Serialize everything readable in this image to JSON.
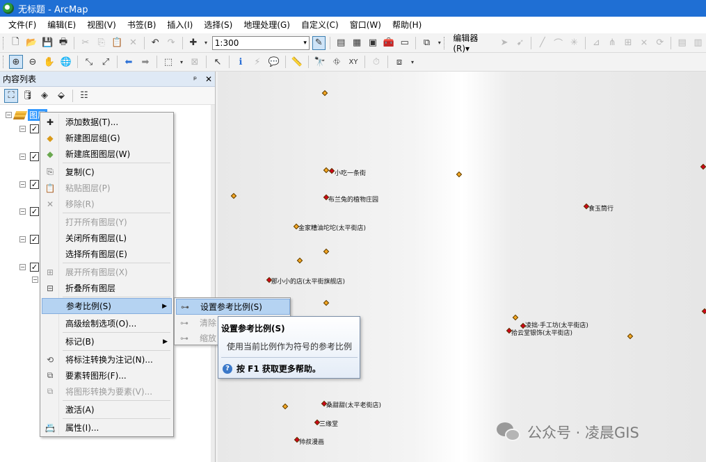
{
  "window": {
    "title": "无标题 - ArcMap"
  },
  "menubar": [
    "文件(F)",
    "编辑(E)",
    "视图(V)",
    "书签(B)",
    "插入(I)",
    "选择(S)",
    "地理处理(G)",
    "自定义(C)",
    "窗口(W)",
    "帮助(H)"
  ],
  "toolbar": {
    "scale": "1:300",
    "editor_label": "编辑器(R)▾"
  },
  "toc": {
    "title": "内容列表",
    "pin": "ᵖ",
    "close": "✕",
    "root_label": "图层"
  },
  "context_menu": [
    {
      "label": "添加数据(T)...",
      "icon": "add-data-icon",
      "enabled": true
    },
    {
      "label": "新建图层组(G)",
      "icon": "new-group-layer-icon",
      "enabled": true
    },
    {
      "label": "新建底图图层(W)",
      "icon": "new-basemap-layer-icon",
      "enabled": true
    },
    {
      "label": "复制(C)",
      "icon": "copy-icon",
      "enabled": true
    },
    {
      "label": "粘贴图层(P)",
      "icon": "paste-icon",
      "enabled": false
    },
    {
      "label": "移除(R)",
      "icon": "remove-icon",
      "enabled": false
    },
    {
      "label": "打开所有图层(Y)",
      "icon": "",
      "enabled": false
    },
    {
      "label": "关闭所有图层(L)",
      "icon": "",
      "enabled": true
    },
    {
      "label": "选择所有图层(E)",
      "icon": "",
      "enabled": true
    },
    {
      "label": "展开所有图层(X)",
      "icon": "expand-icon",
      "enabled": false
    },
    {
      "label": "折叠所有图层",
      "icon": "collapse-icon",
      "enabled": true
    },
    {
      "label": "参考比例(S)",
      "icon": "",
      "enabled": true,
      "submenu": true
    },
    {
      "label": "高级绘制选项(O)...",
      "icon": "",
      "enabled": true
    },
    {
      "label": "标记(B)",
      "icon": "",
      "enabled": true,
      "submenu": true
    },
    {
      "label": "将标注转换为注记(N)...",
      "icon": "convert-labels-icon",
      "enabled": true
    },
    {
      "label": "要素转图形(F)...",
      "icon": "features-to-graphics-icon",
      "enabled": true
    },
    {
      "label": "将图形转换为要素(V)...",
      "icon": "graphics-to-features-icon",
      "enabled": false
    },
    {
      "label": "激活(A)",
      "icon": "",
      "enabled": true
    },
    {
      "label": "属性(I)...",
      "icon": "properties-icon",
      "enabled": true
    }
  ],
  "submenu": [
    {
      "label": "设置参考比例(S)",
      "enabled": true
    },
    {
      "label": "清除",
      "enabled": false
    },
    {
      "label": "缩放",
      "enabled": false
    }
  ],
  "tooltip": {
    "title": "设置参考比例(S)",
    "description": "使用当前比例作为符号的参考比例",
    "help": "按 F1 获取更多帮助。",
    "help_icon": "?"
  },
  "map_labels": [
    "小吃一条街",
    "布兰兔的植物庄园",
    "食玉筒行",
    "金家糟油坨坨(太平街店)",
    "那小小的店(太平街旗舰店)",
    "凌拙·手工坊(太平街店)",
    "拾云堂银饰(太平街店)",
    "桑甜甜(太平老街店)",
    "三缘堂",
    "帅叔漫画"
  ],
  "watermark": "公众号 · 凌晨GIS",
  "colors": {
    "titlebar": "#1f6fd4",
    "poi_orange": "#f5a623",
    "poi_red": "#d0021b",
    "highlight": "#b5d3f2"
  }
}
